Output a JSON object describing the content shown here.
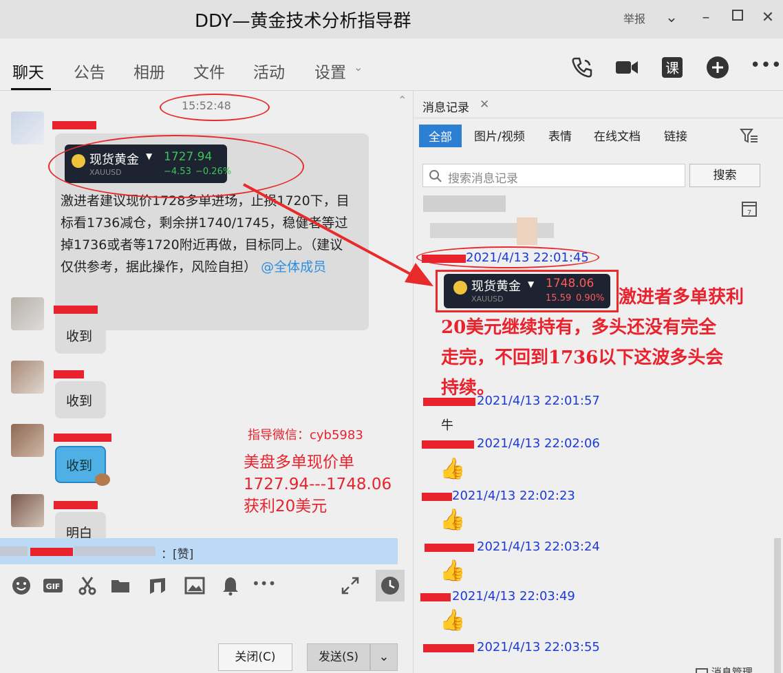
{
  "window": {
    "title": "DDY—黄金技术分析指导群",
    "report": "举报"
  },
  "tabs": [
    "聊天",
    "公告",
    "相册",
    "文件",
    "活动",
    "设置"
  ],
  "chat": {
    "time": "15:52:48",
    "gold_card": {
      "name": "现货黄金",
      "symbol": "XAUUSD",
      "price": "1727.94",
      "change": "−4.53",
      "pct": "−0.26%"
    },
    "message_lines": [
      "激进者建议现价1728多单进场，止损1720下，目",
      "标看1736减仓，剩余拼1740/1745，稳健者等过",
      "掉1736或者等1720附近再做，目标同上。（建议",
      "仅供参考，据此操作，风险自担）"
    ],
    "mention": "@全体成员",
    "replies": [
      "收到",
      "收到",
      "收到",
      "明白"
    ],
    "input_preview": "：[赞]"
  },
  "annotations": {
    "wechat": "指导微信：cyb5983",
    "summary_1": "美盘多单现价单",
    "summary_2": "1727.94---1748.06",
    "summary_3": "获利20美元"
  },
  "buttons": {
    "close": "关闭(C)",
    "send": "发送(S)"
  },
  "history": {
    "tab": "消息记录",
    "filters": [
      "全部",
      "图片/视频",
      "表情",
      "在线文档",
      "链接"
    ],
    "search_placeholder": "搜索消息记录",
    "search_button": "搜索",
    "gold_card": {
      "name": "现货黄金",
      "symbol": "XAUUSD",
      "price": "1748.06",
      "change": "15.59",
      "pct": "0.90%"
    },
    "note_lines": [
      "激进者多单获利",
      "20美元继续持有，多头还没有完全",
      "走完，不回到1736以下这波多头会",
      "持续。"
    ],
    "records": [
      {
        "time": "2021/4/13 22:01:45"
      },
      {
        "time": "2021/4/13 22:01:57",
        "text": "牛"
      },
      {
        "time": "2021/4/13 22:02:06"
      },
      {
        "time": "2021/4/13 22:02:23"
      },
      {
        "time": "2021/4/13 22:03:24"
      },
      {
        "time": "2021/4/13 22:03:49"
      },
      {
        "time": "2021/4/13 22:03:55"
      }
    ],
    "manage": "消息管理"
  }
}
